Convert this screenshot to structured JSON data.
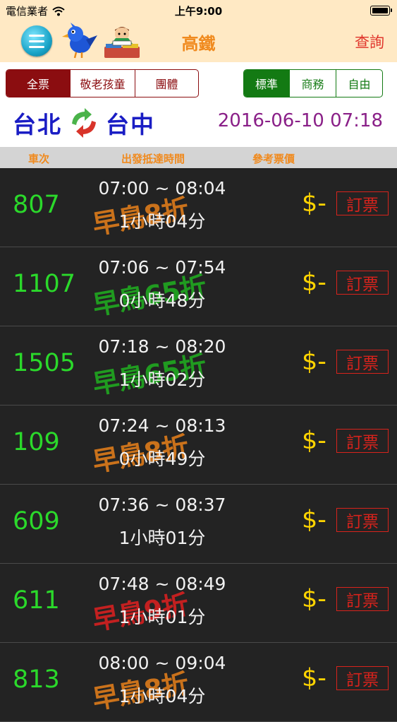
{
  "status_bar": {
    "carrier": "電信業者",
    "time": "上午9:00"
  },
  "nav": {
    "title": "高鐵",
    "query_label": "查詢"
  },
  "ticket_types": [
    "全票",
    "敬老孩童",
    "團體"
  ],
  "ticket_active": 0,
  "car_classes": [
    "標準",
    "商務",
    "自由"
  ],
  "class_active": 0,
  "route": {
    "from": "台北",
    "to": "台中",
    "datetime": "2016-06-10 07:18"
  },
  "columns": {
    "train": "車次",
    "time": "出發抵達時間",
    "fare": "參考票價"
  },
  "trains": [
    {
      "no": "807",
      "times": "07:00 ~ 08:04",
      "duration": "1小時04分",
      "stamp": "早鳥8折",
      "stamp_color": "#e8801a",
      "price": "$-",
      "book": "訂票"
    },
    {
      "no": "1107",
      "times": "07:06 ~ 07:54",
      "duration": "0小時48分",
      "stamp": "早鳥65折",
      "stamp_color": "#20b020",
      "price": "$-",
      "book": "訂票"
    },
    {
      "no": "1505",
      "times": "07:18 ~ 08:20",
      "duration": "1小時02分",
      "stamp": "早鳥65折",
      "stamp_color": "#20b020",
      "price": "$-",
      "book": "訂票"
    },
    {
      "no": "109",
      "times": "07:24 ~ 08:13",
      "duration": "0小時49分",
      "stamp": "早鳥8折",
      "stamp_color": "#e8801a",
      "price": "$-",
      "book": "訂票"
    },
    {
      "no": "609",
      "times": "07:36 ~ 08:37",
      "duration": "1小時01分",
      "stamp": "",
      "stamp_color": "#000000",
      "price": "$-",
      "book": "訂票"
    },
    {
      "no": "611",
      "times": "07:48 ~ 08:49",
      "duration": "1小時01分",
      "stamp": "早鳥9折",
      "stamp_color": "#e02020",
      "price": "$-",
      "book": "訂票"
    },
    {
      "no": "813",
      "times": "08:00 ~ 09:04",
      "duration": "1小時04分",
      "stamp": "早鳥8折",
      "stamp_color": "#e8801a",
      "price": "$-",
      "book": "訂票"
    }
  ]
}
